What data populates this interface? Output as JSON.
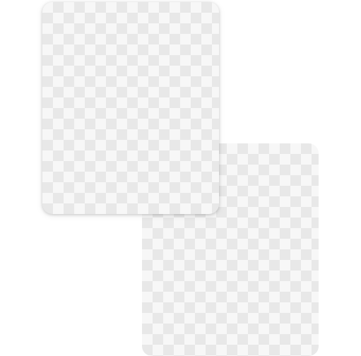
{
  "canvas": {
    "background_color": "#ffffff"
  },
  "cards": [
    {
      "id": "front",
      "content": "transparent-checkerboard",
      "checker_light": "#f7f7f7",
      "checker_dark": "#e8e8e8"
    },
    {
      "id": "back",
      "content": "transparent-checkerboard",
      "checker_light": "#f7f7f7",
      "checker_dark": "#e8e8e8"
    }
  ]
}
